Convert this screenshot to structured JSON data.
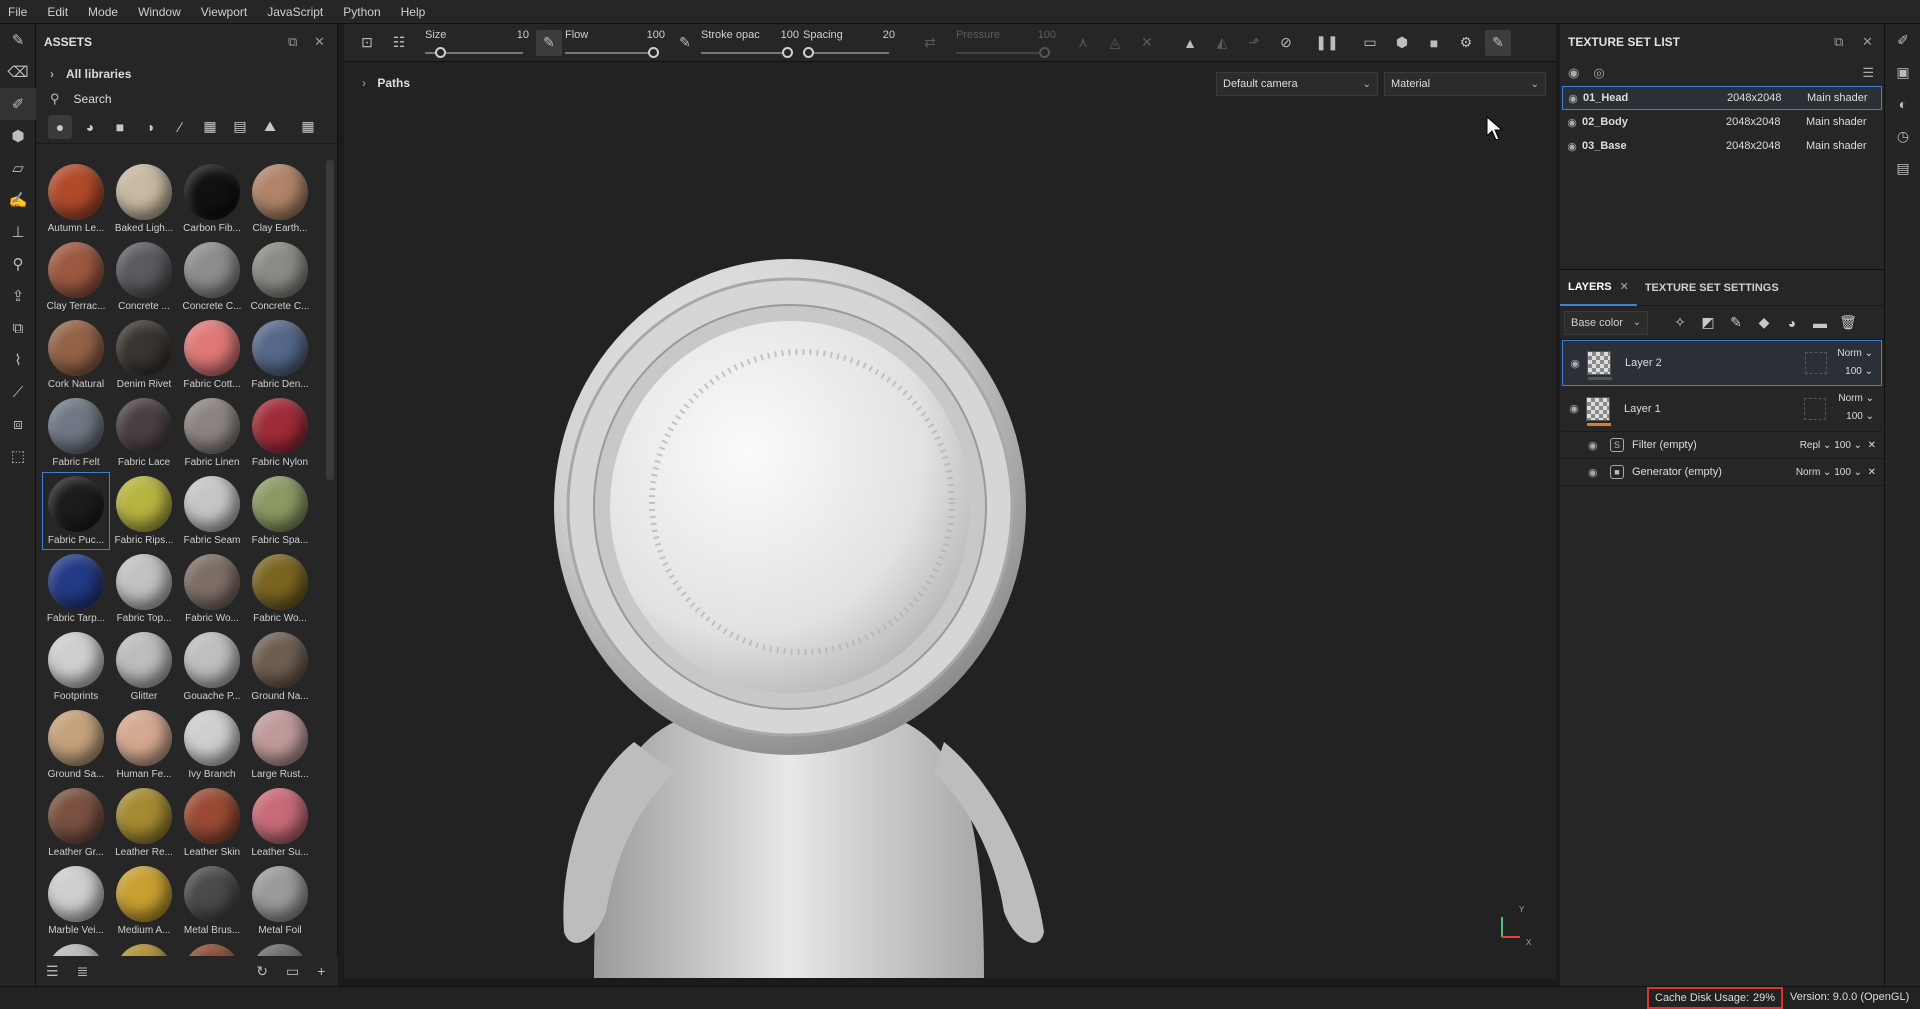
{
  "menu": [
    "File",
    "Edit",
    "Mode",
    "Window",
    "Viewport",
    "JavaScript",
    "Python",
    "Help"
  ],
  "assets": {
    "title": "ASSETS",
    "all_libraries": "All libraries",
    "search": "Search",
    "materials": [
      {
        "label": "Autumn Le...",
        "color": "#b04a2a"
      },
      {
        "label": "Baked Ligh...",
        "color": "#c9b9a2"
      },
      {
        "label": "Carbon Fib...",
        "color": "#111111"
      },
      {
        "label": "Clay Earth...",
        "color": "#b08468"
      },
      {
        "label": "Clay Terrac...",
        "color": "#9c5840"
      },
      {
        "label": "Concrete ...",
        "color": "#5a5b60"
      },
      {
        "label": "Concrete C...",
        "color": "#8d8d8f"
      },
      {
        "label": "Concrete C...",
        "color": "#8c8a84"
      },
      {
        "label": "Cork Natural",
        "color": "#946247"
      },
      {
        "label": "Denim Rivet",
        "color": "#3a3430"
      },
      {
        "label": "Fabric Cott...",
        "color": "#e07878"
      },
      {
        "label": "Fabric Den...",
        "color": "#55688a"
      },
      {
        "label": "Fabric Felt",
        "color": "#6f7884"
      },
      {
        "label": "Fabric Lace",
        "color": "#4a4043"
      },
      {
        "label": "Fabric Linen",
        "color": "#8c8480"
      },
      {
        "label": "Fabric Nylon",
        "color": "#a02c38"
      },
      {
        "label": "Fabric Puc...",
        "color": "#1c1c1c"
      },
      {
        "label": "Fabric Rips...",
        "color": "#b8b440"
      },
      {
        "label": "Fabric Seam",
        "color": "#c6c6c6"
      },
      {
        "label": "Fabric Spa...",
        "color": "#8a9a62"
      },
      {
        "label": "Fabric Tarp...",
        "color": "#233a86"
      },
      {
        "label": "Fabric Top...",
        "color": "#c2c2c2"
      },
      {
        "label": "Fabric Wo...",
        "color": "#7d6e66"
      },
      {
        "label": "Fabric Wo...",
        "color": "#7a6420"
      },
      {
        "label": "Footprints",
        "color": "#cfcfcf"
      },
      {
        "label": "Glitter",
        "color": "#bdbdbd"
      },
      {
        "label": "Gouache P...",
        "color": "#bfbfbf"
      },
      {
        "label": "Ground Na...",
        "color": "#6e5e50"
      },
      {
        "label": "Ground Sa...",
        "color": "#c4a27c"
      },
      {
        "label": "Human Fe...",
        "color": "#d5a890"
      },
      {
        "label": "Ivy Branch",
        "color": "#cfcfcf"
      },
      {
        "label": "Large Rust...",
        "color": "#c09a9a"
      },
      {
        "label": "Leather Gr...",
        "color": "#7a5040"
      },
      {
        "label": "Leather Re...",
        "color": "#a48a30"
      },
      {
        "label": "Leather Skin",
        "color": "#9a4a34"
      },
      {
        "label": "Leather Su...",
        "color": "#c86a78"
      },
      {
        "label": "Marble Vei...",
        "color": "#cfcfcf"
      },
      {
        "label": "Medium A...",
        "color": "#c8a030"
      },
      {
        "label": "Metal Brus...",
        "color": "#4a4a4a"
      },
      {
        "label": "Metal Foil",
        "color": "#9a9a9a"
      },
      {
        "label": "",
        "color": "#bbbbbb"
      },
      {
        "label": "",
        "color": "#b09030"
      },
      {
        "label": "",
        "color": "#8a4a34"
      },
      {
        "label": "",
        "color": "#6a6a6a"
      }
    ]
  },
  "toolbar": {
    "size_label": "Size",
    "size_value": "10",
    "size_pct": 0.12,
    "flow_label": "Flow",
    "flow_value": "100",
    "flow_pct": 1.0,
    "opacity_label": "Stroke opac",
    "opacity_value": "100",
    "opacity_pct": 1.0,
    "spacing_label": "Spacing",
    "spacing_value": "20",
    "spacing_pct": 0.0,
    "pressure_label": "Pressure",
    "pressure_value": "100",
    "pressure_pct": 1.0
  },
  "viewport": {
    "paths": "Paths",
    "camera": "Default camera",
    "mode": "Material",
    "axis_y": "Y",
    "axis_x": "X"
  },
  "texture_sets": {
    "title": "TEXTURE SET LIST",
    "rows": [
      {
        "name": "01_Head",
        "res": "2048x2048",
        "shader": "Main shader"
      },
      {
        "name": "02_Body",
        "res": "2048x2048",
        "shader": "Main shader"
      },
      {
        "name": "03_Base",
        "res": "2048x2048",
        "shader": "Main shader"
      }
    ]
  },
  "layers": {
    "tab_layers": "LAYERS",
    "tab_settings": "TEXTURE SET SETTINGS",
    "channel": "Base color",
    "layer2": {
      "name": "Layer 2",
      "blend": "Norm",
      "opacity": "100",
      "accent": "#555555"
    },
    "layer1": {
      "name": "Layer 1",
      "blend": "Norm",
      "opacity": "100",
      "accent": "#e07a20"
    },
    "filter": {
      "name": "Filter (empty)",
      "blend": "Repl",
      "opacity": "100"
    },
    "generator": {
      "name": "Generator (empty)",
      "blend": "Norm",
      "opacity": "100"
    }
  },
  "status": {
    "cache_label": "Cache Disk Usage:",
    "cache_value": "29%",
    "version": "Version: 9.0.0 (OpenGL)"
  }
}
